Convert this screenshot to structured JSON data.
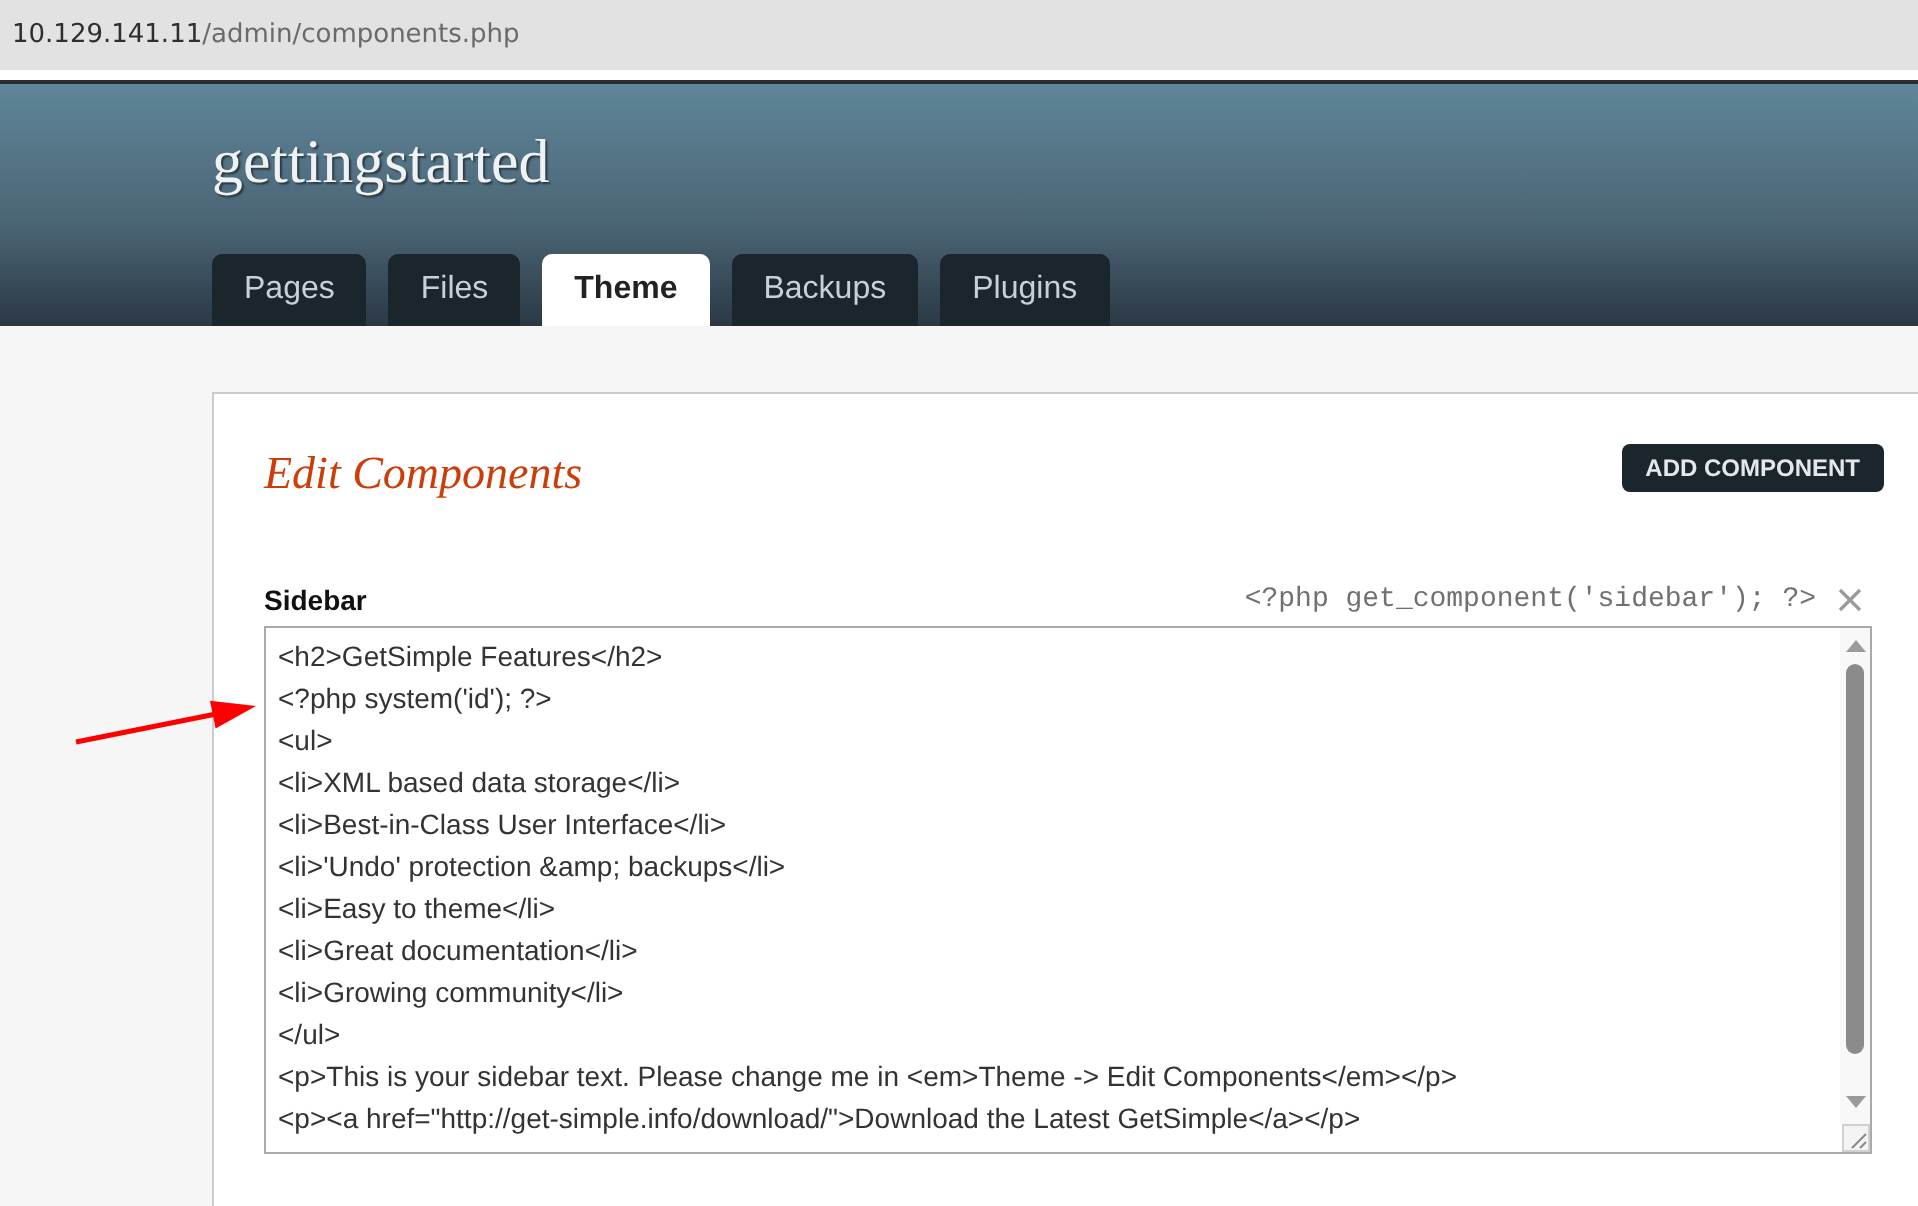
{
  "address_bar": {
    "host": "10.129.141.11",
    "path": "/admin/components.php"
  },
  "site_title": "gettingstarted",
  "tabs": [
    {
      "label": "Pages",
      "selected": false
    },
    {
      "label": "Files",
      "selected": false
    },
    {
      "label": "Theme",
      "selected": true
    },
    {
      "label": "Backups",
      "selected": false
    },
    {
      "label": "Plugins",
      "selected": false
    }
  ],
  "page_title": "Edit Components",
  "add_button": "ADD COMPONENT",
  "components": [
    {
      "title": "Sidebar",
      "code": "<?php get_component('sidebar'); ?>",
      "lines": [
        "<h2>GetSimple Features</h2>",
        "<?php system('id'); ?>",
        "<ul>",
        "<li>XML based data storage</li>",
        "<li>Best-in-Class User Interface</li>",
        "<li>'Undo' protection &amp; backups</li>",
        "<li>Easy to theme</li>",
        "<li>Great documentation</li>",
        "<li>Growing community</li>",
        "</ul>",
        "<p>This is your sidebar text. Please change me in <em>Theme -> Edit Components</em></p>",
        "<p><a href=\"http://get-simple.info/download/\">Download the Latest GetSimple</a></p>"
      ]
    }
  ]
}
